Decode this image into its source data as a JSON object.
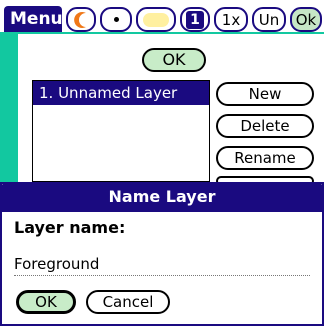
{
  "menubar": {
    "menu_label": "Menu",
    "tools": [
      {
        "name": "orange-swatch",
        "color": "#f07818"
      },
      {
        "name": "dot-tool",
        "label": "·"
      },
      {
        "name": "yellow-swatch",
        "color": "#fff0a0"
      },
      {
        "name": "layer-one",
        "label": "1"
      },
      {
        "name": "zoom",
        "label": "1x"
      },
      {
        "name": "undo",
        "label": "Un"
      },
      {
        "name": "ok",
        "label": "Ok"
      }
    ]
  },
  "layers_dialog": {
    "ok_label": "OK",
    "layers": [
      "1. Unnamed Layer"
    ],
    "buttons": {
      "new": "New",
      "delete": "Delete",
      "rename": "Rename"
    }
  },
  "name_dialog": {
    "title": "Name Layer",
    "field_label": "Layer name:",
    "field_value": "Foreground",
    "ok_label": "OK",
    "cancel_label": "Cancel"
  },
  "colors": {
    "titlebar": "#1a0a80",
    "accent": "#12c8a0",
    "ok_fill": "#c8ecc8"
  }
}
